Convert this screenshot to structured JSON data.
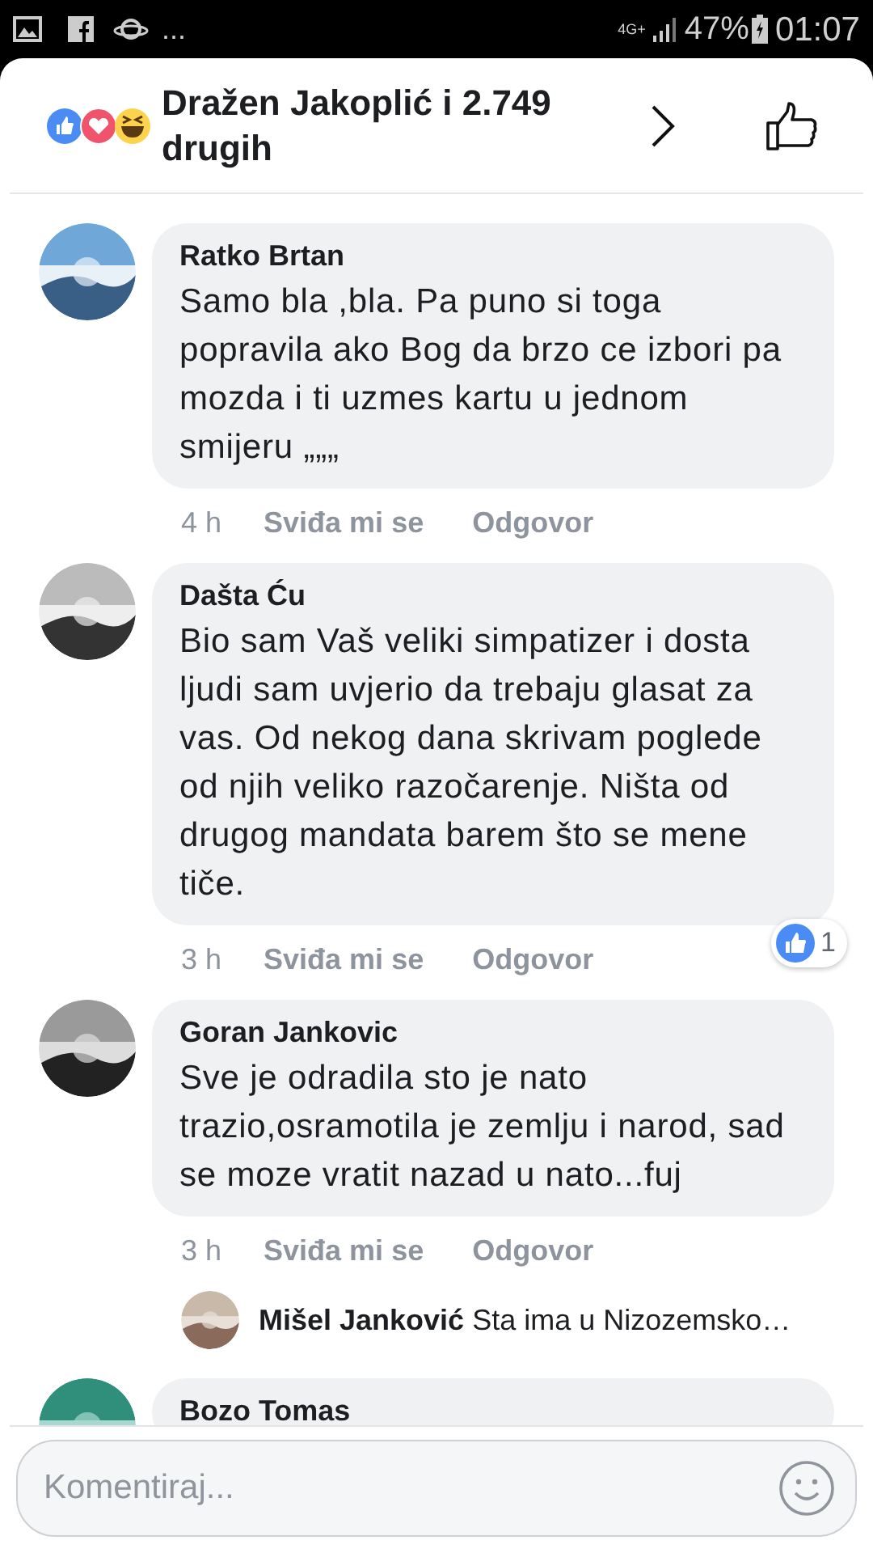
{
  "status_bar": {
    "more": "...",
    "network": "4G+",
    "battery": "47%",
    "time": "01:07"
  },
  "header": {
    "reactions_text": "Dražen Jakoplić i 2.749 drugih"
  },
  "comments": [
    {
      "author": "Ratko Brtan",
      "text": "Samo bla ,bla. Pa puno si toga popravila  ako Bog da brzo ce izbori pa mozda i ti uzmes kartu u jednom smijeru  „„„",
      "time": "4 h",
      "like": "Sviđa mi se",
      "reply": "Odgovor"
    },
    {
      "author": "Dašta Ću",
      "text": "Bio sam Vaš veliki simpatizer i dosta ljudi sam uvjerio da trebaju glasat za vas. Od nekog dana skrivam poglede od njih veliko razočarenje. Ništa od drugog mandata barem što se mene tiče.",
      "time": "3 h",
      "like": "Sviđa mi se",
      "reply": "Odgovor",
      "reaction_count": "1"
    },
    {
      "author": "Goran Jankovic",
      "text": "Sve je odradila sto je nato trazio,osramotila je zemlju i narod, sad se moze vratit nazad u nato...fuj",
      "time": "3 h",
      "like": "Sviđa mi se",
      "reply": "Odgovor",
      "replies": [
        {
          "author": "Mišel Janković",
          "text": "Sta ima u Nizozemsko…"
        }
      ]
    },
    {
      "author": "Bozo Tomas"
    }
  ],
  "composer": {
    "placeholder": "Komentiraj..."
  }
}
